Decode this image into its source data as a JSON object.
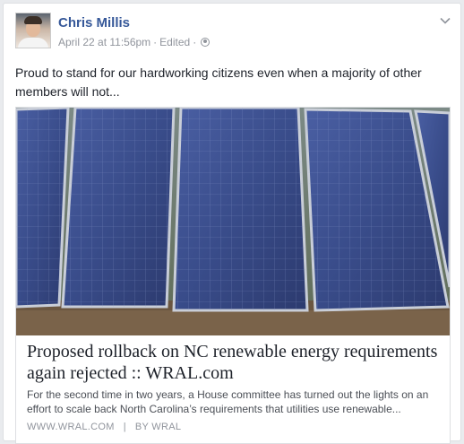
{
  "post": {
    "author": "Chris Millis",
    "timestamp": "April 22 at 11:56pm",
    "separator": "·",
    "edited": "Edited",
    "separator2": "·",
    "privacy_icon": "globe-icon",
    "menu_icon": "chevron-down-icon",
    "text": "Proud to stand for our hardworking citizens even when a majority of other members will not..."
  },
  "link": {
    "image_description": "solar-panels",
    "title": "Proposed rollback on NC renewable energy requirements again rejected :: WRAL.com",
    "description": "For the second time in two years, a House committee has turned out the lights on an effort to scale back North Carolina’s requirements that utilities use renewable...",
    "domain": "WWW.WRAL.COM",
    "divider": "|",
    "byline": "BY WRAL"
  },
  "colors": {
    "name_link": "#365899",
    "meta_gray": "#90949c",
    "panel_blue": "#3a4e8c"
  }
}
